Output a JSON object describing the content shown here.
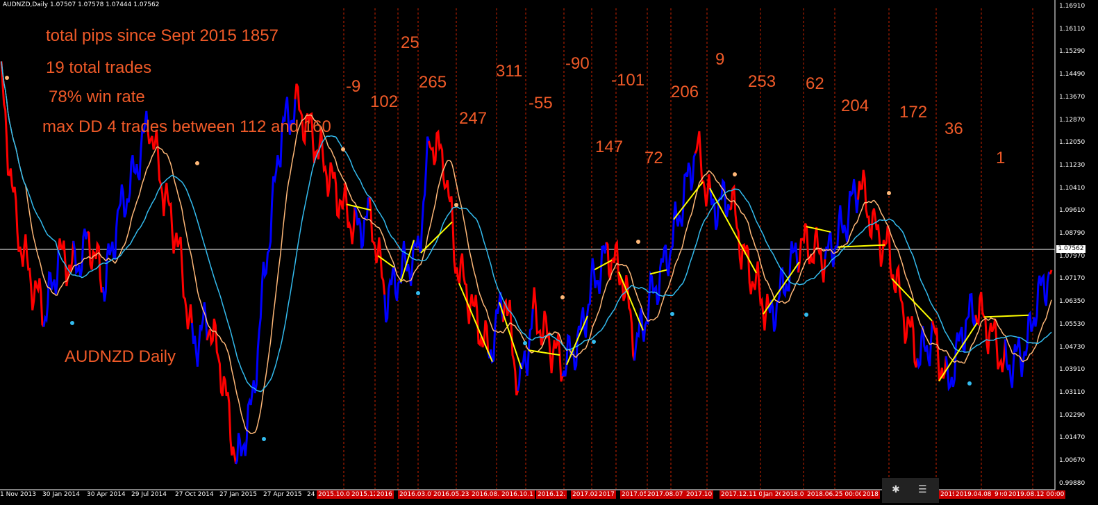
{
  "window": {
    "header": "AUDNZD,Daily  1.07507 1.07578 1.07444 1.07562"
  },
  "annotations": {
    "total_pips": "total pips since Sept 2015  1857",
    "total_trades": "19 total trades",
    "win_rate": "78% win rate",
    "max_dd": "max DD 4 trades between 112 and 160",
    "chart_name": "AUDNZD Daily"
  },
  "last_price": "1.07562",
  "colors": {
    "background": "#000000",
    "bull": "#0000ff",
    "bear": "#ff0000",
    "ma_fast": "#ffb878",
    "ma_slow": "#33bbee",
    "trend_line": "#ffff00",
    "annotation": "#f05a28",
    "separator": "#cc2200"
  },
  "icons": {
    "bluetooth": "bluetooth-icon",
    "notifications": "action-center-icon"
  },
  "chart_data": {
    "type": "line",
    "symbol": "AUDNZD",
    "timeframe": "Daily",
    "ylim": [
      0.9988,
      1.1706
    ],
    "y_ticks": [
      "1.16910",
      "1.16110",
      "1.15290",
      "1.14490",
      "1.13670",
      "1.12870",
      "1.12050",
      "1.11230",
      "1.10410",
      "1.09610",
      "1.08790",
      "1.07970",
      "1.07170",
      "1.06350",
      "1.05530",
      "1.04730",
      "1.03910",
      "1.03110",
      "1.02290",
      "1.01470",
      "1.00670",
      "0.99880"
    ],
    "x_ticks": [
      "1 Nov 2013",
      "30 Jan 2014",
      "30 Apr 2014",
      "29 Jul 2014",
      "27 Oct 2014",
      "27 Jan 2015",
      "27 Apr 2015",
      "24"
    ],
    "x_ticks_highlighted": [
      "2015.10.0",
      "2015.12",
      "2016",
      "2016.03.07",
      "2016.05.23 0",
      "2016.08.",
      "2016.10.1",
      "2016.12.",
      "2017.02",
      "2017",
      "2017.05.29",
      "2017.08.07",
      "2017.10",
      "2017.12.11 00:00",
      "Jan 201",
      "2018.0",
      "2018.06.25 00:00",
      "2018",
      "2019.0",
      "2019.04.08 00:00",
      "9",
      "2019.08.12 00:00"
    ],
    "trade_pips": [
      {
        "label": "-9",
        "value": -9
      },
      {
        "label": "102",
        "value": 102
      },
      {
        "label": "25",
        "value": 25
      },
      {
        "label": "265",
        "value": 265
      },
      {
        "label": "247",
        "value": 247
      },
      {
        "label": "311",
        "value": 311
      },
      {
        "label": "-55",
        "value": -55
      },
      {
        "label": "-90",
        "value": -90
      },
      {
        "label": "147",
        "value": 147
      },
      {
        "label": "-101",
        "value": -101
      },
      {
        "label": "72",
        "value": 72
      },
      {
        "label": "206",
        "value": 206
      },
      {
        "label": "9",
        "value": 9
      },
      {
        "label": "253",
        "value": 253
      },
      {
        "label": "62",
        "value": 62
      },
      {
        "label": "204",
        "value": 204
      },
      {
        "label": "172",
        "value": 172
      },
      {
        "label": "36",
        "value": 36
      },
      {
        "label": "1",
        "value": 1
      }
    ],
    "price_path": [
      [
        "2013-11-01",
        1.143
      ],
      [
        "2013-12-01",
        1.092
      ],
      [
        "2014-01-01",
        1.072
      ],
      [
        "2014-01-30",
        1.06
      ],
      [
        "2014-03-01",
        1.081
      ],
      [
        "2014-04-01",
        1.076
      ],
      [
        "2014-04-30",
        1.087
      ],
      [
        "2014-06-01",
        1.07
      ],
      [
        "2014-07-01",
        1.096
      ],
      [
        "2014-07-29",
        1.108
      ],
      [
        "2014-09-01",
        1.13
      ],
      [
        "2014-10-01",
        1.103
      ],
      [
        "2014-10-27",
        1.088
      ],
      [
        "2014-12-01",
        1.048
      ],
      [
        "2015-01-01",
        1.058
      ],
      [
        "2015-01-27",
        1.04
      ],
      [
        "2015-03-01",
        1.005
      ],
      [
        "2015-04-01",
        1.027
      ],
      [
        "2015-04-27",
        1.075
      ],
      [
        "2015-06-01",
        1.127
      ],
      [
        "2015-07-01",
        1.135
      ],
      [
        "2015-08-01",
        1.125
      ],
      [
        "2015-09-01",
        1.112
      ],
      [
        "2015-10-01",
        1.1
      ],
      [
        "2015-11-01",
        1.09
      ],
      [
        "2015-12-01",
        1.095
      ],
      [
        "2016-01-01",
        1.065
      ],
      [
        "2016-02-01",
        1.075
      ],
      [
        "2016-03-07",
        1.082
      ],
      [
        "2016-04-01",
        1.123
      ],
      [
        "2016-05-01",
        1.115
      ],
      [
        "2016-05-23",
        1.08
      ],
      [
        "2016-07-01",
        1.06
      ],
      [
        "2016-08-01",
        1.045
      ],
      [
        "2016-09-01",
        1.068
      ],
      [
        "2016-10-01",
        1.032
      ],
      [
        "2016-11-01",
        1.06
      ],
      [
        "2016-12-01",
        1.05
      ],
      [
        "2017-01-01",
        1.041
      ],
      [
        "2017-02-01",
        1.05
      ],
      [
        "2017-03-01",
        1.07
      ],
      [
        "2017-04-01",
        1.082
      ],
      [
        "2017-05-01",
        1.074
      ],
      [
        "2017-05-29",
        1.048
      ],
      [
        "2017-07-01",
        1.066
      ],
      [
        "2017-08-07",
        1.083
      ],
      [
        "2017-09-01",
        1.1
      ],
      [
        "2017-10-01",
        1.12
      ],
      [
        "2017-11-01",
        1.098
      ],
      [
        "2017-12-11",
        1.102
      ],
      [
        "2018-01-01",
        1.083
      ],
      [
        "2018-02-01",
        1.07
      ],
      [
        "2018-03-01",
        1.058
      ],
      [
        "2018-04-01",
        1.071
      ],
      [
        "2018-05-01",
        1.086
      ],
      [
        "2018-06-25",
        1.08
      ],
      [
        "2018-08-01",
        1.092
      ],
      [
        "2018-09-01",
        1.108
      ],
      [
        "2018-10-01",
        1.09
      ],
      [
        "2018-11-01",
        1.082
      ],
      [
        "2018-12-01",
        1.06
      ],
      [
        "2019-01-01",
        1.044
      ],
      [
        "2019-02-01",
        1.052
      ],
      [
        "2019-03-01",
        1.033
      ],
      [
        "2019-04-08",
        1.057
      ],
      [
        "2019-05-01",
        1.062
      ],
      [
        "2019-06-01",
        1.052
      ],
      [
        "2019-07-01",
        1.04
      ],
      [
        "2019-08-12",
        1.048
      ],
      [
        "2019-09-01",
        1.065
      ],
      [
        "2019-10-01",
        1.0756
      ]
    ]
  }
}
